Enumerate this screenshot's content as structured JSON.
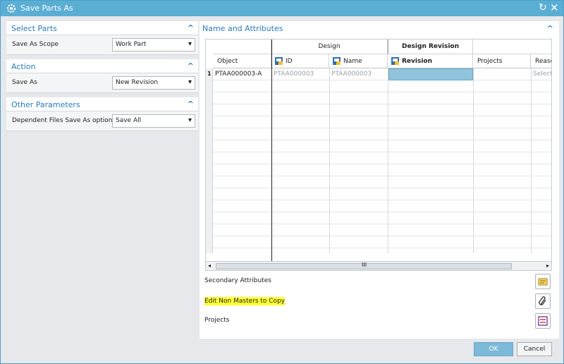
{
  "window": {
    "title": "Save Parts As",
    "icons": {
      "title": "gear-icon",
      "rotate": "rotate-icon",
      "close": "close-icon"
    }
  },
  "left": {
    "select_parts": {
      "header": "Select Parts",
      "label": "Save As Scope",
      "value": "Work Part"
    },
    "action": {
      "header": "Action",
      "label": "Save As",
      "value": "New Revision"
    },
    "other": {
      "header": "Other Parameters",
      "label": "Dependent Files Save As option",
      "value": "Save All"
    }
  },
  "right": {
    "header": "Name and Attributes",
    "grid": {
      "group_headers": {
        "design": "Design",
        "design_revision": "Design Revision"
      },
      "columns": [
        "Object",
        "ID",
        "Name",
        "Revision",
        "Projects",
        "Reason"
      ],
      "rows": [
        {
          "num": "1",
          "object": "PTAA000003-A",
          "id": "PTAA000003",
          "name": "PTAA000003",
          "revision": "",
          "projects": "",
          "reason": "Selecte"
        }
      ],
      "scroll_mark": "III"
    },
    "options": {
      "secondary": "Secondary Attributes",
      "edit_non_masters": "Edit Non Masters to Copy",
      "projects": "Projects"
    }
  },
  "footer": {
    "ok": "OK",
    "cancel": "Cancel"
  },
  "colors": {
    "accent": "#5aaed4",
    "header_text": "#2b7bb9",
    "highlight": "#ffff33",
    "selected_cell": "#8fc4dc"
  }
}
